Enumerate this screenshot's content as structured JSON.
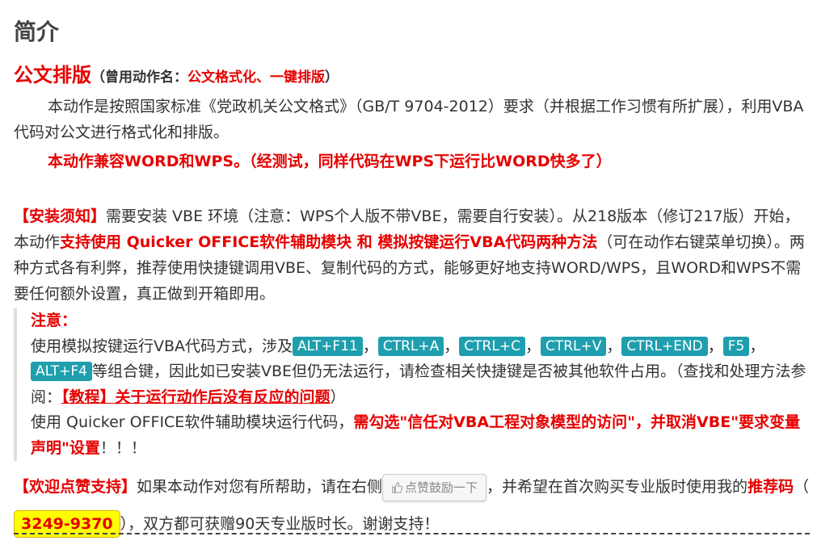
{
  "intro_title": "简介",
  "heading": {
    "main": "公文排版",
    "open_paren": "（曾用动作名：",
    "alias_1": "公文格式化",
    "sep": "、",
    "alias_2": "一键排版",
    "close_paren": "）"
  },
  "intro_paragraph": "本动作是按照国家标准《党政机关公文格式》（GB/T 9704-2012）要求（并根据工作习惯有所扩展），利用VBA代码对公文进行格式化和排版。",
  "compat_note": "本动作兼容WORD和WPS。（经测试，同样代码在WPS下运行比WORD快多了）",
  "install": {
    "label": "【安装须知】",
    "text_1": "需要安装 VBE 环境（注意：WPS个人版不带VBE，需要自行安装）。从218版本（修订217版）开始，本动作",
    "highlight": "支持使用 Quicker OFFICE软件辅助模块 和 模拟按键运行VBA代码两种方法",
    "text_2": "（可在动作右键菜单切换）。两种方式各有利弊，推荐使用快捷键调用VBE、复制代码的方式，能够更好地支持WORD/WPS，且WORD和WPS不需要任何额外设置，真正做到开箱即用。"
  },
  "note": {
    "title": "注意：",
    "line1_prefix": "使用模拟按键运行VBA代码方式，涉及",
    "keys": [
      "ALT+F11",
      "CTRL+A",
      "CTRL+C",
      "CTRL+V",
      "CTRL+END",
      "F5",
      "ALT+F4"
    ],
    "comma": "，",
    "line1_suffix": "等组合键，因此如已安装VBE但仍无法运行，请检查相关快捷键是否被其他软件占用。（查找和处理方法参阅：",
    "link": "【教程】关于运行动作后没有反应的问题",
    "line1_end": "）",
    "line2_prefix": "使用 Quicker OFFICE软件辅助模块运行代码，",
    "line2_highlight": "需勾选\"信任对VBA工程对象模型的访问\"，并取消VBE\"要求变量声明\"设置",
    "line2_end": "！！！"
  },
  "support": {
    "label": "【欢迎点赞支持】",
    "text_1": "如果本动作对您有所帮助，请在右侧",
    "like_button": "点赞鼓励一下",
    "text_2": "，并希望在首次购买专业版时使用我的",
    "ref_label": "推荐码",
    "open_paren": "（",
    "code": "3249-9370",
    "text_3": "），双方都可获赠90天专业版时长。谢谢支持！"
  },
  "colors": {
    "accent_red": "#e60000",
    "key_badge": "#1f9fae",
    "code_bg": "#ffff00"
  }
}
